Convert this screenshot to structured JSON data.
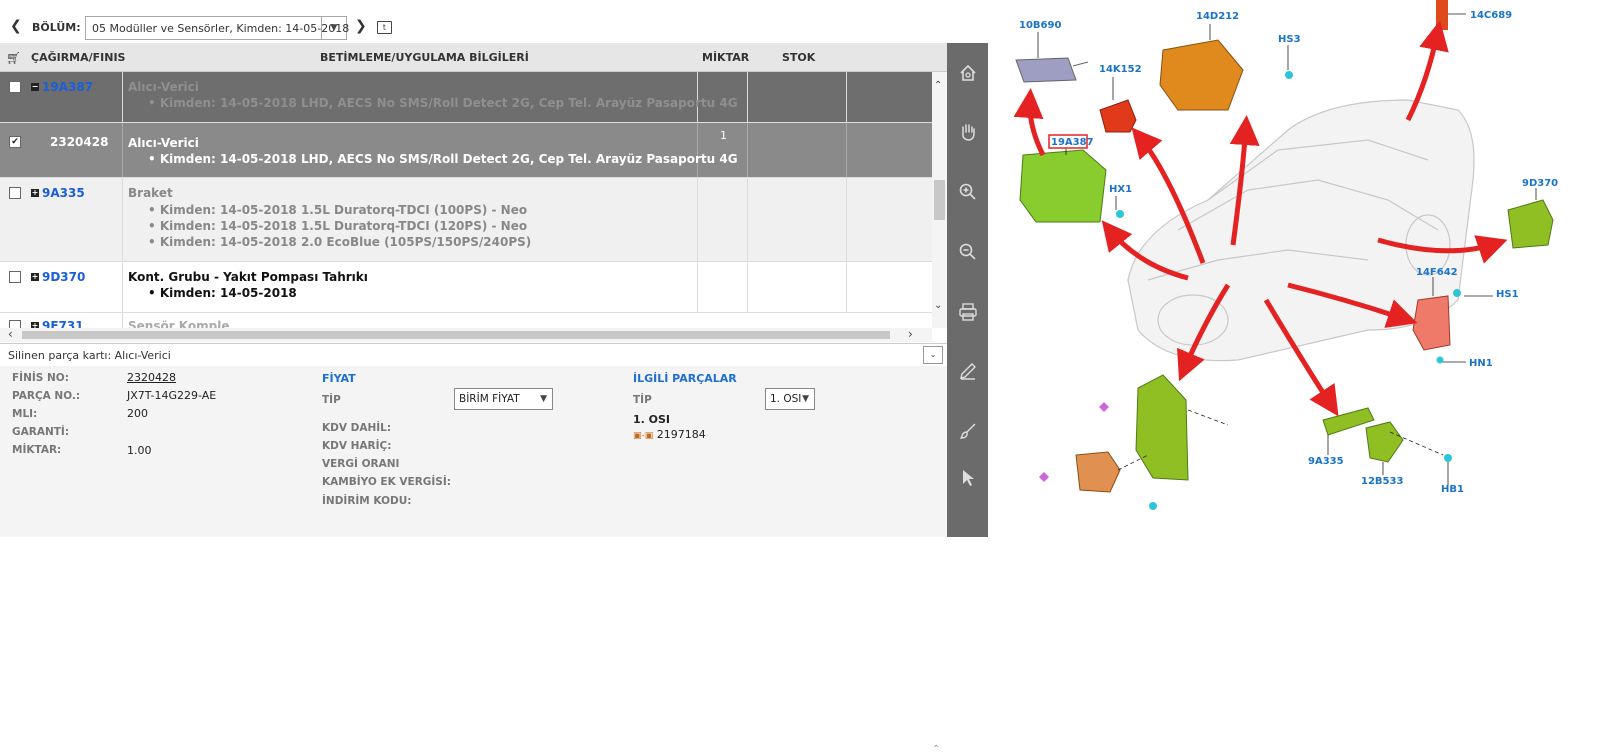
{
  "toolbar": {
    "section_label": "BÖLÜM:",
    "section_value": "05 Modüller ve Sensörler, Kimden: 14-05-2018"
  },
  "table": {
    "headers": [
      "ÇAĞIRMA/FINIS",
      "BETİMLEME/UYGULAMA BİLGİLERİ",
      "MİKTAR",
      "STOK"
    ],
    "rows": [
      {
        "code": "19A387",
        "title": "Alıcı-Verici",
        "lines": [
          "Kimden: 14-05-2018 LHD, AECS No SMS/Roll Detect 2G, Cep Tel. Arayüz Pasaportu 4G"
        ],
        "qty": ""
      },
      {
        "code": "2320428",
        "title": "Alıcı-Verici",
        "lines": [
          "Kimden: 14-05-2018 LHD, AECS No SMS/Roll Detect 2G, Cep Tel. Arayüz Pasaportu 4G"
        ],
        "qty": "1"
      },
      {
        "code": "9A335",
        "title": "Braket",
        "lines": [
          "Kimden: 14-05-2018 1.5L Duratorq-TDCI (100PS) - Neo",
          "Kimden: 14-05-2018 1.5L Duratorq-TDCI (120PS) - Neo",
          "Kimden: 14-05-2018 2.0 EcoBlue (105PS/150PS/240PS)"
        ],
        "qty": ""
      },
      {
        "code": "9D370",
        "title": "Kont. Grubu - Yakıt Pompası Tahrıkı",
        "lines": [
          "Kimden: 14-05-2018"
        ],
        "qty": ""
      },
      {
        "code": "9E731",
        "title": "Sensör Komple",
        "lines": [],
        "qty": ""
      }
    ]
  },
  "deleted_bar": "Silinen parça kartı: Alıcı-Verici",
  "details": {
    "finis_no_label": "FİNİS NO:",
    "finis_no": "2320428",
    "parca_no_label": "PARÇA NO.:",
    "parca_no": "JX7T-14G229-AE",
    "mli_label": "MLI:",
    "mli": "200",
    "garanti_label": "GARANTİ:",
    "miktar_label": "MİKTAR:",
    "miktar": "1.00",
    "price_heading": "FİYAT",
    "tip_label": "TİP",
    "tip_value": "BİRİM FİYAT",
    "kdv_dahil": "KDV DAHİL:",
    "kdv_haric": "KDV HARİÇ:",
    "vergi_orani": "VERGİ ORANI",
    "kambiyo": "KAMBİYO EK VERGİSİ:",
    "indirim": "İNDİRİM KODU:",
    "related_heading": "İLGİLİ PARÇALAR",
    "rel_tip_label": "TİP",
    "rel_tip_value": "1. OSI",
    "rel_item_title": "1. OSI",
    "rel_item_code": "2197184"
  },
  "diagram": {
    "labels": [
      "10B690",
      "14D212",
      "HS3",
      "14C689",
      "14K152",
      "19A387",
      "HX1",
      "9D370",
      "14F642",
      "HS1",
      "HN1",
      "9A335",
      "12B533",
      "HB1"
    ],
    "highlighted": "19A387"
  },
  "sidebar_icons": [
    "home-icon",
    "hand-icon",
    "zoom-in-icon",
    "zoom-out-icon",
    "print-icon",
    "pencil-icon",
    "brush-icon",
    "pointer-icon"
  ]
}
